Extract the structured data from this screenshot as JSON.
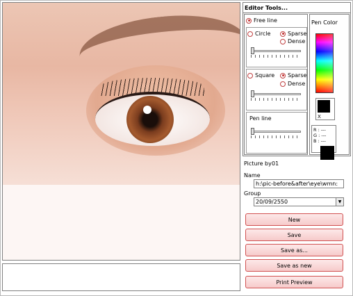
{
  "panel": {
    "title": "Editor Tools...",
    "free_line": "Free line",
    "circle": "Circle",
    "sparse1": "Sparse",
    "dense1": "Dense",
    "square": "Square",
    "sparse2": "Sparse",
    "dense2": "Dense",
    "pen_line": "Pen line",
    "pen_color": "Pen Color",
    "swatch_x": "X",
    "rgb_r": "R : ---",
    "rgb_g": "G : ---",
    "rgb_b": "B : ---"
  },
  "info": {
    "picture_by_label": "Picture by",
    "picture_by_value": "01",
    "name_label": "Name",
    "name_value": "h:\\pic-before&after\\eye\\wmn:",
    "group_label": "Group",
    "group_value": "20/09/2550"
  },
  "buttons": {
    "new": "New",
    "save": "Save",
    "save_as": "Save as...",
    "save_as_new": "Save as new",
    "print_preview": "Print Preview"
  },
  "colors": {
    "accent": "#d05050",
    "button_fill": "#f6caca",
    "pen_color": "#000000"
  },
  "icons": {
    "dropdown": "chevron-down-icon"
  }
}
